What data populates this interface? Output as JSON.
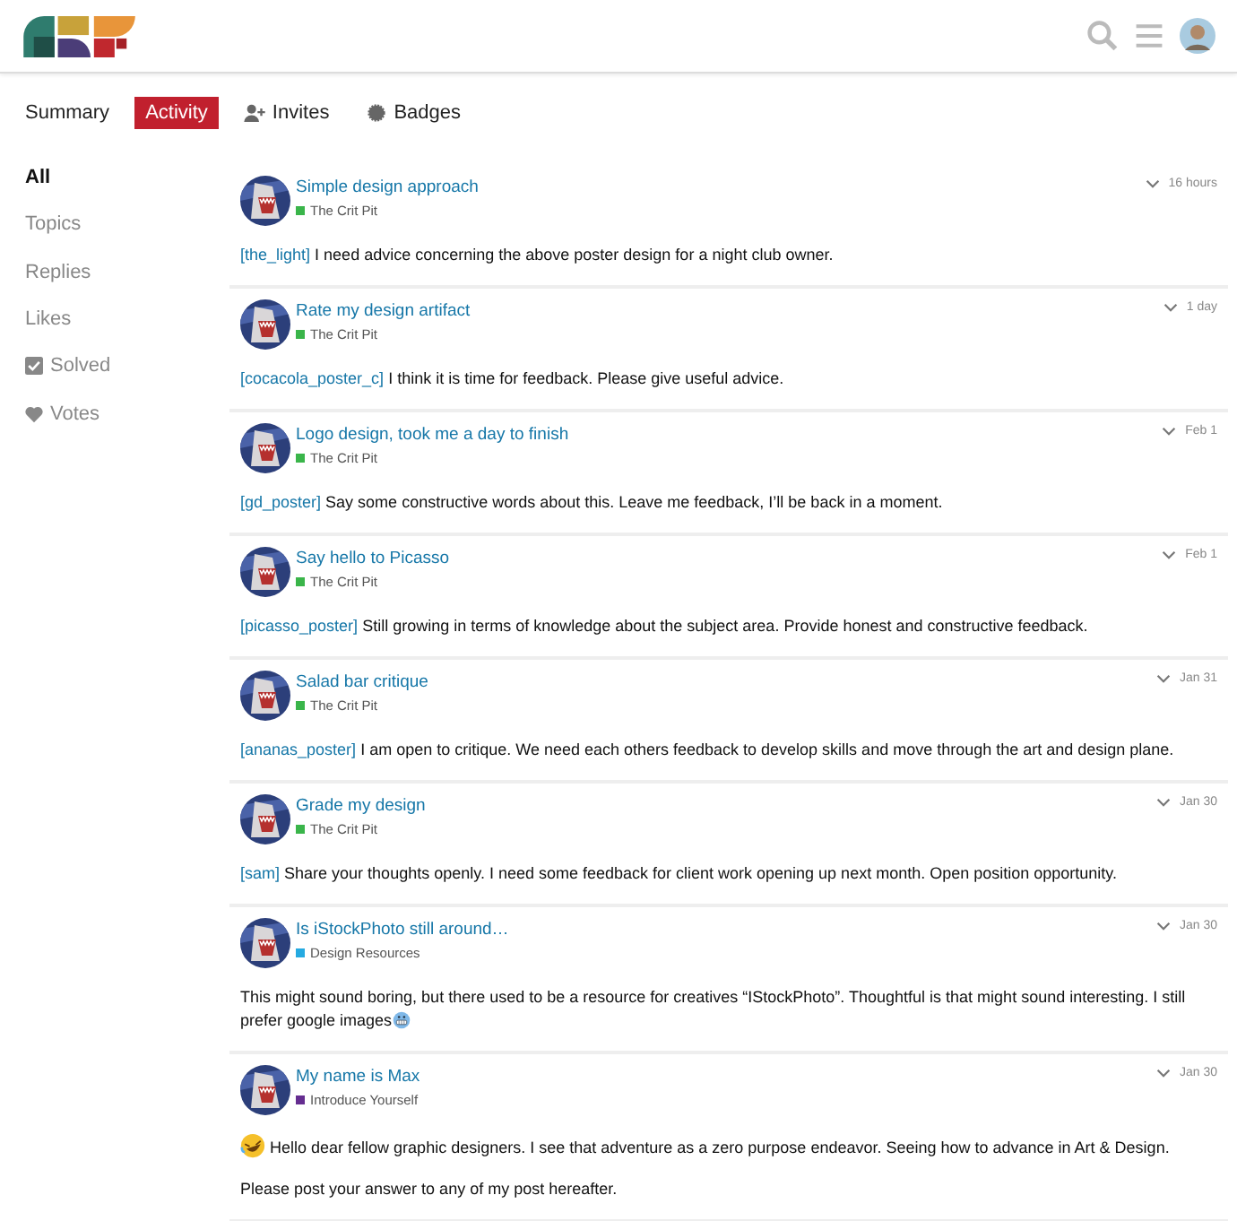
{
  "header": {
    "logo": {
      "kind": "logo"
    }
  },
  "tabs": [
    {
      "label": "Summary",
      "kind": "plain",
      "selected": false
    },
    {
      "label": "Activity",
      "kind": "plain",
      "selected": true
    },
    {
      "label": "Invites",
      "kind": "invites",
      "selected": false
    },
    {
      "label": "Badges",
      "kind": "badges",
      "selected": false
    }
  ],
  "sidebar": {
    "items": [
      {
        "label": "All",
        "kind": "plain",
        "selected": true
      },
      {
        "label": "Topics",
        "kind": "plain",
        "selected": false
      },
      {
        "label": "Replies",
        "kind": "plain",
        "selected": false
      },
      {
        "label": "Likes",
        "kind": "plain",
        "selected": false
      },
      {
        "label": "Solved",
        "kind": "solved",
        "selected": false
      },
      {
        "label": "Votes",
        "kind": "votes",
        "selected": false
      }
    ]
  },
  "posts": [
    {
      "title": "Simple design approach",
      "category": "The Crit Pit",
      "color": "#3ab54a",
      "date": "16 hours",
      "paragraphs": [
        [
          {
            "kind": "link",
            "text": "[the_light]"
          },
          {
            "kind": "text",
            "text": "I need advice concerning the above poster design for a night club owner."
          }
        ]
      ]
    },
    {
      "title": "Rate my design artifact",
      "category": "The Crit Pit",
      "color": "#3ab54a",
      "date": "1 day",
      "paragraphs": [
        [
          {
            "kind": "link",
            "text": "[cocacola_poster_c]"
          },
          {
            "kind": "text",
            "text": "I think it is time for feedback. Please give useful advice."
          }
        ]
      ]
    },
    {
      "title": "Logo design, took me a day to finish",
      "category": "The Crit Pit",
      "color": "#3ab54a",
      "date": "Feb 1",
      "paragraphs": [
        [
          {
            "kind": "link",
            "text": "[gd_poster]"
          },
          {
            "kind": "text",
            "text": "Say some constructive words about this. Leave me feedback, I’ll be back in a moment."
          }
        ]
      ]
    },
    {
      "title": "Say hello to Picasso",
      "category": "The Crit Pit",
      "color": "#3ab54a",
      "date": "Feb 1",
      "paragraphs": [
        [
          {
            "kind": "link",
            "text": "[picasso_poster]"
          },
          {
            "kind": "text",
            "text": "Still growing in terms of knowledge about the subject area. Provide honest and constructive feedback."
          }
        ]
      ]
    },
    {
      "title": "Salad bar critique",
      "category": "The Crit Pit",
      "color": "#3ab54a",
      "date": "Jan 31",
      "paragraphs": [
        [
          {
            "kind": "link",
            "text": "[ananas_poster]"
          },
          {
            "kind": "text",
            "text": "I am open to critique. We need each others feedback to develop skills and move through the art and design plane."
          }
        ]
      ]
    },
    {
      "title": "Grade my design",
      "category": "The Crit Pit",
      "color": "#3ab54a",
      "date": "Jan 30",
      "paragraphs": [
        [
          {
            "kind": "link",
            "text": "[sam]"
          },
          {
            "kind": "text",
            "text": "Share your thoughts openly. I need some feedback for client work opening up next month. Open position opportunity."
          }
        ]
      ]
    },
    {
      "title": "Is iStockPhoto still around…",
      "category": "Design Resources",
      "color": "#25aae1",
      "date": "Jan 30",
      "paragraphs": [
        [
          {
            "kind": "text",
            "text": "This might sound boring, but there used to be a resource for creatives “IStockPhoto”. Thoughtful is that might sound interesting. I still prefer google images"
          },
          {
            "kind": "grimace"
          }
        ]
      ]
    },
    {
      "title": "My name is Max",
      "category": "Introduce Yourself",
      "color": "#652d90",
      "date": "Jan 30",
      "paragraphs": [
        [
          {
            "kind": "laugh"
          },
          {
            "kind": "text",
            "text": "Hello dear fellow graphic designers. I see that adventure as a zero purpose endeavor. Seeing how to advance in Art & Design."
          }
        ],
        [
          {
            "kind": "text",
            "text": "Please post your answer to any of my post hereafter."
          }
        ]
      ]
    }
  ]
}
